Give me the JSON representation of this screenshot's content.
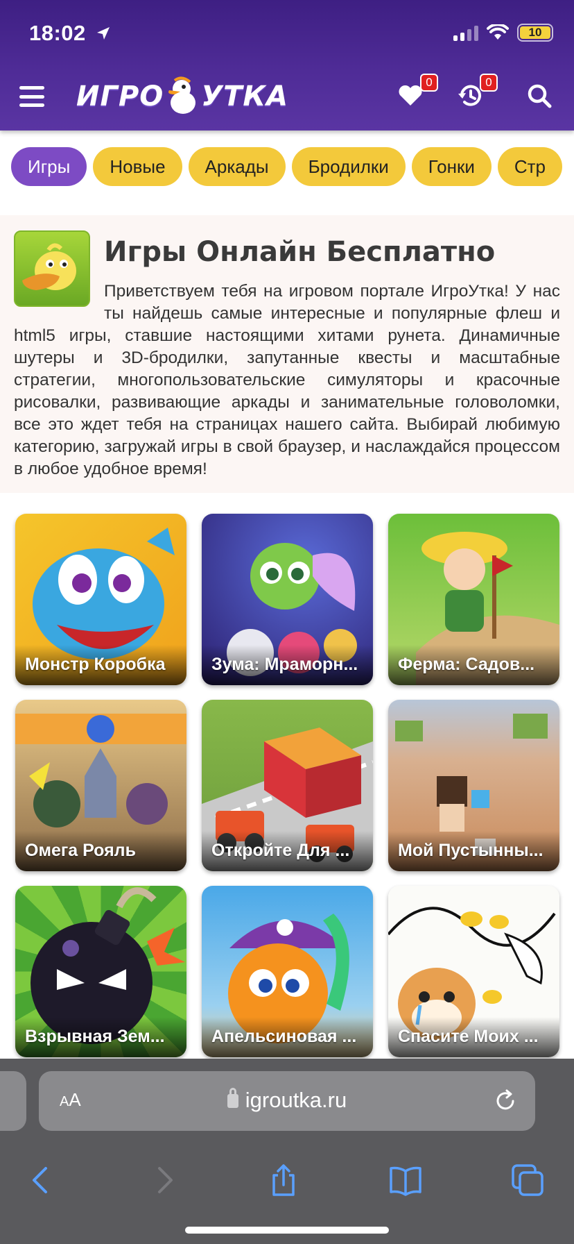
{
  "status_bar": {
    "time": "18:02",
    "battery": "10"
  },
  "header": {
    "logo_left": "ИГРО",
    "logo_right": "УТКА",
    "favorites_count": "0",
    "history_count": "0"
  },
  "categories": [
    "Игры",
    "Новые",
    "Аркады",
    "Бродилки",
    "Гонки",
    "Стр"
  ],
  "intro": {
    "title": "Игры Онлайн Бесплатно",
    "text": "Приветствуем тебя на игровом портале ИгроУтка! У нас ты найдешь самые интересные и популярные флеш и html5 игры, ставшие настоящими хитами рунета. Динамичные шутеры и 3D-бродилки, запутанные квесты и масштабные стратегии, многопользовательские симуляторы и красочные рисовалки, развивающие аркады и занимательные головоломки, все это ждет тебя на страницах нашего сайта. Выбирай любимую категорию, загружай игры в свой браузер, и наслаждайся процессом в любое удобное время!"
  },
  "games": [
    {
      "title": "Монстр Коробка"
    },
    {
      "title": "Зума: Мраморн..."
    },
    {
      "title": "Ферма: Садов..."
    },
    {
      "title": "Омега Рояль"
    },
    {
      "title": "Откройте Для ..."
    },
    {
      "title": "Мой Пустынны..."
    },
    {
      "title": "Взрывная Зем..."
    },
    {
      "title": "Апельсиновая ..."
    },
    {
      "title": "Спасите Моих ..."
    }
  ],
  "browser": {
    "text_size": "AA",
    "url": "igroutka.ru"
  },
  "colors": {
    "header": "#4f2c97",
    "chip": "#f3c93b",
    "chip_active": "#7d4bc4",
    "badge": "#e02020"
  }
}
